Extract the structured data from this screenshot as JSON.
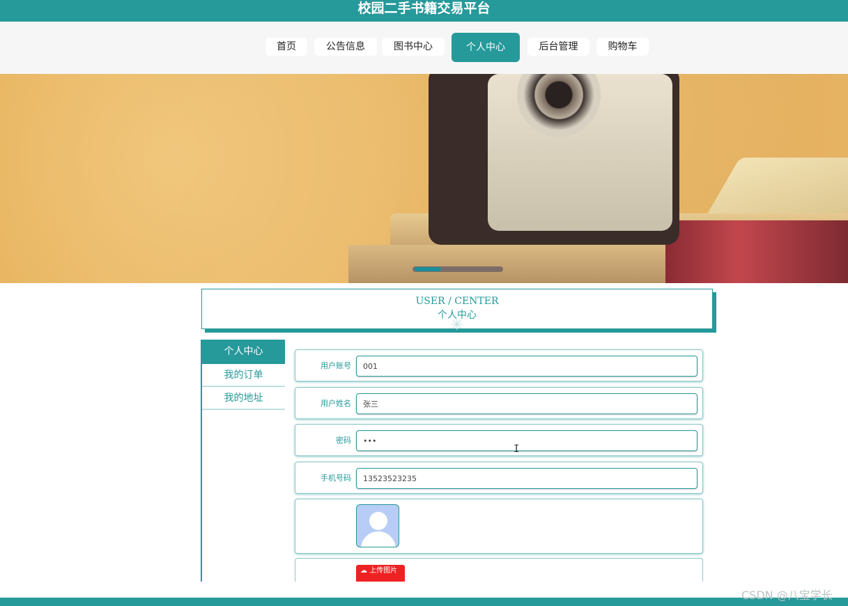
{
  "app": {
    "title": "校园二手书籍交易平台"
  },
  "nav": {
    "items": [
      {
        "label": "首页"
      },
      {
        "label": "公告信息"
      },
      {
        "label": "图书中心"
      },
      {
        "label": "个人中心",
        "active": true
      },
      {
        "label": "后台管理"
      },
      {
        "label": "购物车"
      }
    ]
  },
  "banner": {
    "carousel_slide_index": 1,
    "carousel_indicator": "dots-bar"
  },
  "section": {
    "title_en": "USER / CENTER",
    "title_zh": "个人中心"
  },
  "sidebar": {
    "items": [
      {
        "label": "个人中心",
        "active": true
      },
      {
        "label": "我的订单"
      },
      {
        "label": "我的地址"
      }
    ]
  },
  "form": {
    "username": {
      "label": "用户账号",
      "value": "001"
    },
    "name": {
      "label": "用户姓名",
      "value": "张三"
    },
    "password": {
      "label": "密码",
      "value": "•••"
    },
    "phone": {
      "label": "手机号码",
      "value": "13523523235"
    },
    "avatar": {
      "icon": "user-avatar-icon"
    },
    "upload": {
      "label": "上传图片",
      "icon": "cloud-upload-icon"
    }
  },
  "watermark": "CSDN @八宝学长",
  "colors": {
    "accent": "#26999a",
    "upload": "#ee2222",
    "background": "#ffffff"
  }
}
